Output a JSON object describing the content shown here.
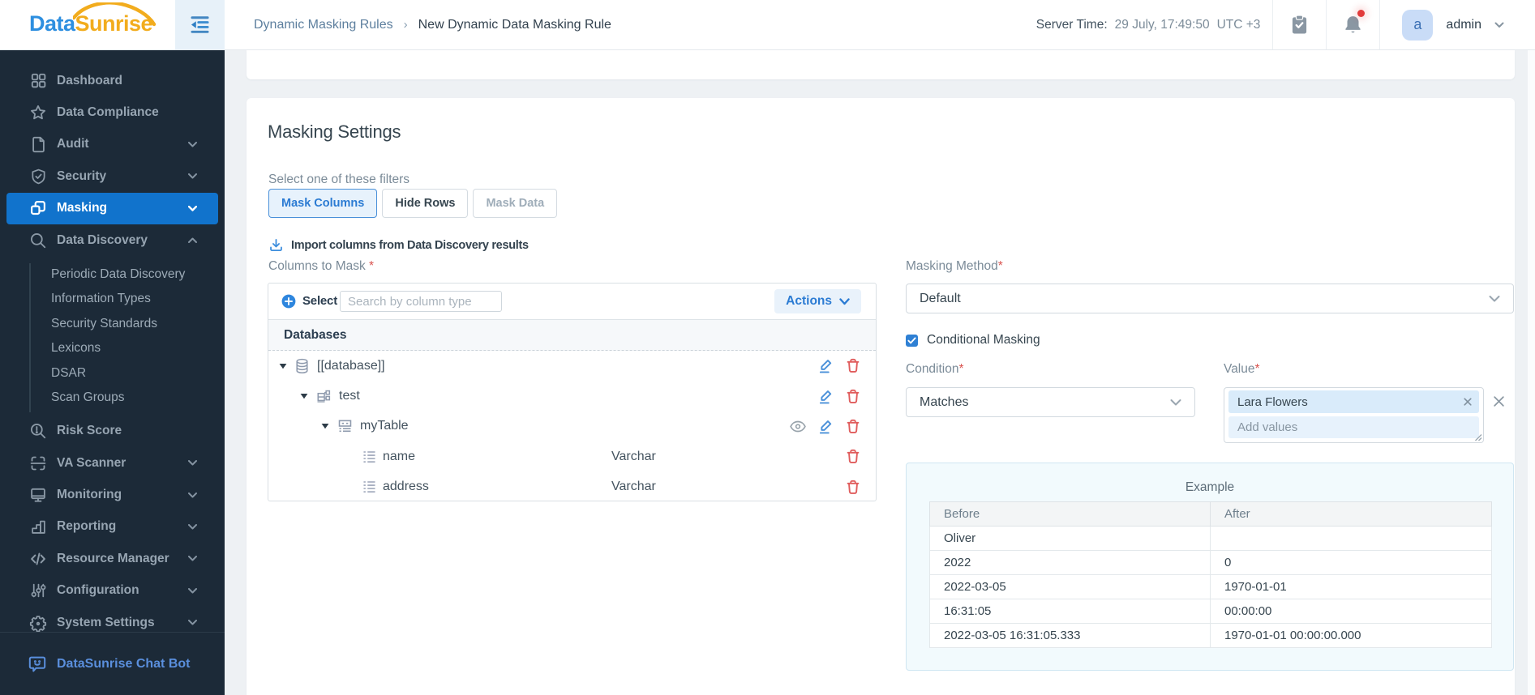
{
  "logo": {
    "part1": "Data",
    "part2": "Sunrise"
  },
  "header": {
    "breadcrumb": {
      "parent": "Dynamic Masking Rules",
      "separator": "›",
      "current": "New Dynamic Data Masking Rule"
    },
    "server_time": {
      "label": "Server Time:",
      "value": "29 July, 17:49:50",
      "timezone": "UTC +3"
    },
    "user": {
      "initial": "a",
      "name": "admin"
    }
  },
  "sidebar": {
    "items": [
      {
        "label": "Dashboard"
      },
      {
        "label": "Data Compliance"
      },
      {
        "label": "Audit"
      },
      {
        "label": "Security"
      },
      {
        "label": "Masking"
      },
      {
        "label": "Data Discovery"
      },
      {
        "label": "Risk Score"
      },
      {
        "label": "VA Scanner"
      },
      {
        "label": "Monitoring"
      },
      {
        "label": "Reporting"
      },
      {
        "label": "Resource Manager"
      },
      {
        "label": "Configuration"
      },
      {
        "label": "System Settings"
      }
    ],
    "discovery_subitems": [
      {
        "label": "Periodic Data Discovery"
      },
      {
        "label": "Information Types"
      },
      {
        "label": "Security Standards"
      },
      {
        "label": "Lexicons"
      },
      {
        "label": "DSAR"
      },
      {
        "label": "Scan Groups"
      }
    ],
    "chatbot_label": "DataSunrise Chat Bot",
    "active_item": "Masking",
    "active_color": "#1173cc"
  },
  "masking": {
    "title": "Masking Settings",
    "filters_label": "Select one of these filters",
    "filters": [
      {
        "label": "Mask Columns",
        "state": "active"
      },
      {
        "label": "Hide Rows",
        "state": "normal"
      },
      {
        "label": "Mask Data",
        "state": "disabled"
      }
    ],
    "import_label": "Import columns from Data Discovery results",
    "columns_label": "Columns to Mask",
    "required_mark": "*",
    "tree": {
      "select_label": "Select",
      "search_placeholder": "Search by column type",
      "actions_label": "Actions",
      "header": "Databases",
      "rows": [
        {
          "label": "[[database]]",
          "type": "",
          "kind": "database"
        },
        {
          "label": "test",
          "type": "",
          "kind": "schema"
        },
        {
          "label": "myTable",
          "type": "",
          "kind": "table"
        },
        {
          "label": "name",
          "type": "Varchar",
          "kind": "column"
        },
        {
          "label": "address",
          "type": "Varchar",
          "kind": "column"
        }
      ]
    },
    "method_label": "Masking Method",
    "method_value": "Default",
    "conditional_label": "Conditional Masking",
    "conditional_checked": true,
    "condition_label": "Condition",
    "condition_value": "Matches",
    "value_label": "Value",
    "value_chip": "Lara Flowers",
    "value_placeholder": "Add values"
  },
  "example": {
    "title": "Example",
    "columns": [
      "Before",
      "After"
    ],
    "rows": [
      [
        "Oliver",
        ""
      ],
      [
        "2022",
        "0"
      ],
      [
        "2022-03-05",
        "1970-01-01"
      ],
      [
        "16:31:05",
        "00:00:00"
      ],
      [
        "2022-03-05 16:31:05.333",
        "1970-01-01 00:00:00.000"
      ]
    ]
  },
  "colors": {
    "sidebar_bg": "#1c2a38",
    "active_blue": "#1173cc",
    "link_blue": "#2b7bd3",
    "logo_blue": "#2e8fe0",
    "logo_orange": "#f2ac1d",
    "danger_red": "#e05c5c",
    "text_dark": "#36454f",
    "label_gray": "#7b8b98"
  }
}
